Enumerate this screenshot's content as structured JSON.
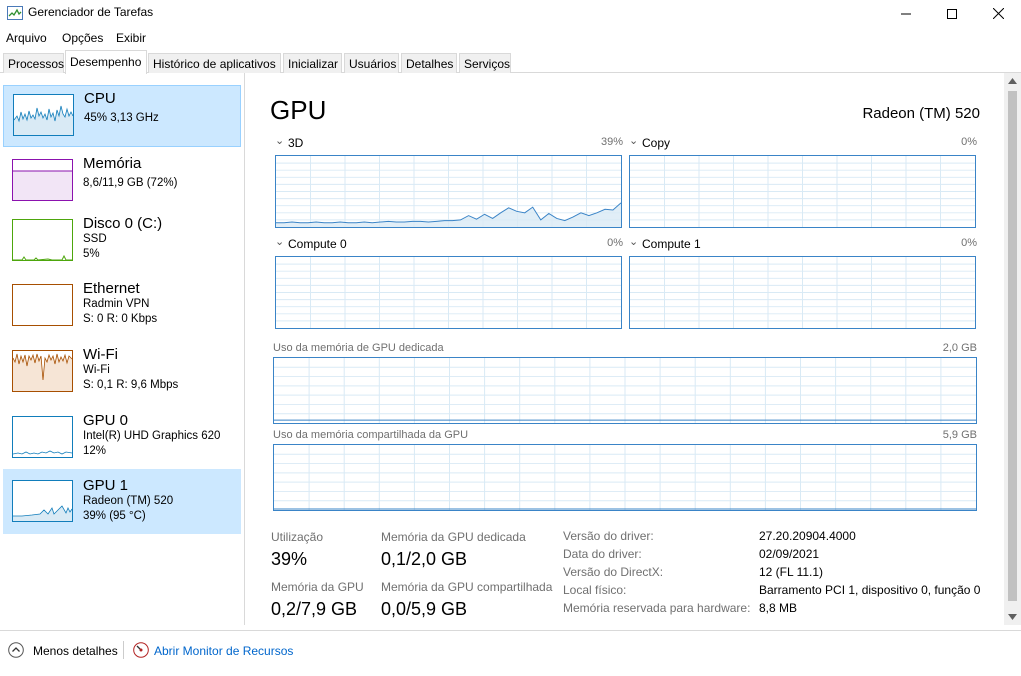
{
  "window": {
    "title": "Gerenciador de Tarefas",
    "minimize_glyph": "—",
    "maximize_glyph": "☐",
    "close_glyph": "✕"
  },
  "menu": [
    "Arquivo",
    "Opções",
    "Exibir"
  ],
  "tabs": [
    "Processos",
    "Desempenho",
    "Histórico de aplicativos",
    "Inicializar",
    "Usuários",
    "Detalhes",
    "Serviços"
  ],
  "active_tab": "Desempenho",
  "sidebar": [
    {
      "name": "CPU",
      "line1": "45%  3,13 GHz",
      "line2": "",
      "color": "#117dbb"
    },
    {
      "name": "Memória",
      "line1": "8,6/11,9 GB (72%)",
      "line2": "",
      "color": "#8b12ae"
    },
    {
      "name": "Disco 0 (C:)",
      "line1": "SSD",
      "line2": "5%",
      "color": "#4da60c"
    },
    {
      "name": "Ethernet",
      "line1": "Radmin VPN",
      "line2": "S: 0  R: 0 Kbps",
      "color": "#a74f01"
    },
    {
      "name": "Wi-Fi",
      "line1": "Wi-Fi",
      "line2": "S: 0,1  R: 9,6 Mbps",
      "color": "#a74f01"
    },
    {
      "name": "GPU 0",
      "line1": "Intel(R) UHD Graphics 620",
      "line2": "12%",
      "color": "#117dbb"
    },
    {
      "name": "GPU 1",
      "line1": "Radeon (TM) 520",
      "line2": "39% (95 °C)",
      "color": "#117dbb"
    }
  ],
  "main": {
    "title": "GPU",
    "device": "Radeon (TM) 520",
    "engines": [
      {
        "name": "3D",
        "value": "39%"
      },
      {
        "name": "Copy",
        "value": "0%"
      },
      {
        "name": "Compute 0",
        "value": "0%"
      },
      {
        "name": "Compute 1",
        "value": "0%"
      }
    ],
    "dedicated_label": "Uso da memória de GPU dedicada",
    "dedicated_max": "2,0 GB",
    "shared_label": "Uso da memória compartilhada da GPU",
    "shared_max": "5,9 GB",
    "stats": {
      "utilization_label": "Utilização",
      "utilization_value": "39%",
      "dedicated_label": "Memória da GPU dedicada",
      "dedicated_value": "0,1/2,0 GB",
      "gpu_mem_label": "Memória da GPU",
      "gpu_mem_value": "0,2/7,9 GB",
      "shared_label": "Memória da GPU compartilhada",
      "shared_value": "0,0/5,9 GB"
    },
    "info": [
      {
        "label": "Versão do driver:",
        "value": "27.20.20904.4000"
      },
      {
        "label": "Data do driver:",
        "value": "02/09/2021"
      },
      {
        "label": "Versão do DirectX:",
        "value": "12 (FL 11.1)"
      },
      {
        "label": "Local físico:",
        "value": "Barramento PCI 1, dispositivo 0, função 0"
      },
      {
        "label": "Memória reservada para hardware:",
        "value": "8,8 MB"
      }
    ]
  },
  "footer": {
    "less_details": "Menos detalhes",
    "resource_monitor": "Abrir Monitor de Recursos"
  },
  "graph_3d_data": [
    6,
    6,
    7,
    6,
    6,
    7,
    6,
    6,
    7,
    6,
    6,
    7,
    6,
    7,
    8,
    7,
    7,
    8,
    8,
    7,
    8,
    9,
    9,
    10,
    16,
    11,
    18,
    12,
    20,
    27,
    22,
    20,
    28,
    10,
    19,
    12,
    9,
    14,
    20,
    16,
    20,
    25,
    24,
    34
  ]
}
